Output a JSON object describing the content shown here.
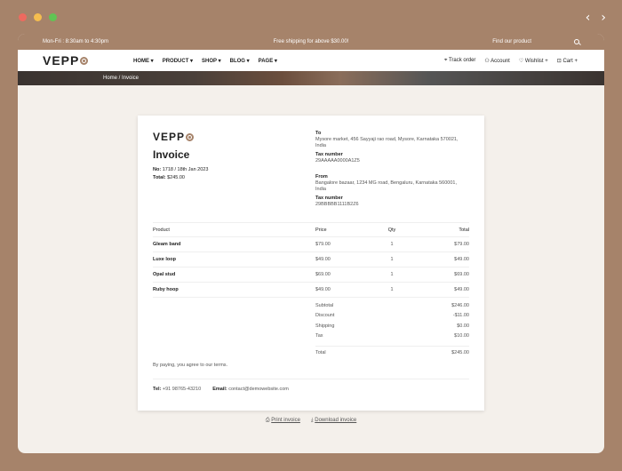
{
  "topbar": {
    "hours": "Mon-Fri : 8:30am to 4:30pm",
    "promo": "Free shipping for above $30.00!",
    "search_placeholder": "Find our product"
  },
  "header": {
    "logo": "VEPP",
    "menu": [
      "HOME",
      "PRODUCT",
      "SHOP",
      "BLOG",
      "PAGE"
    ],
    "track_order": "Track order",
    "account": "Account",
    "wishlist": "Wishlist",
    "cart": "Cart"
  },
  "breadcrumb": "Home / Invoice",
  "invoice": {
    "logo": "VEPP",
    "title": "Invoice",
    "no_label": "No:",
    "no_value": "1718 / 18th Jan 2023",
    "total_label": "Total:",
    "total_value": "$245.00",
    "to_label": "To",
    "to_address": "Mysore market, 456 Sayyaji rao road, Mysore, Karnataka 570021, India",
    "tax_label": "Tax number",
    "to_tax": "29AAAAA0000A1Z5",
    "from_label": "From",
    "from_address": "Bangalore bazaar, 1234 MG road, Bengaluru, Karnataka 560001, India",
    "from_tax": "29BBBBB1111B2Z6",
    "columns": [
      "Product",
      "Price",
      "Qty",
      "Total"
    ],
    "items": [
      {
        "product": "Gleam band",
        "price": "$79.00",
        "qty": "1",
        "total": "$79.00"
      },
      {
        "product": "Luxe loop",
        "price": "$49.00",
        "qty": "1",
        "total": "$49.00"
      },
      {
        "product": "Opal stud",
        "price": "$69.00",
        "qty": "1",
        "total": "$69.00"
      },
      {
        "product": "Ruby hoop",
        "price": "$49.00",
        "qty": "1",
        "total": "$49.00"
      }
    ],
    "summary": [
      {
        "label": "Subtotal",
        "value": "$246.00"
      },
      {
        "label": "Discount",
        "value": "-$11.00"
      },
      {
        "label": "Shipping",
        "value": "$0.00"
      },
      {
        "label": "Tax",
        "value": "$10.00"
      }
    ],
    "grand_label": "Total",
    "grand_value": "$245.00",
    "terms": "By paying, you agree to our terms.",
    "tel_label": "Tel:",
    "tel_value": "+91 98765-43210",
    "email_label": "Email:",
    "email_value": "contact@demowebsite.com"
  },
  "actions": {
    "print": "Print invoice",
    "download": "Download invoice"
  },
  "colors": {
    "brand": "#a6836a",
    "background": "#f4f0eb"
  }
}
